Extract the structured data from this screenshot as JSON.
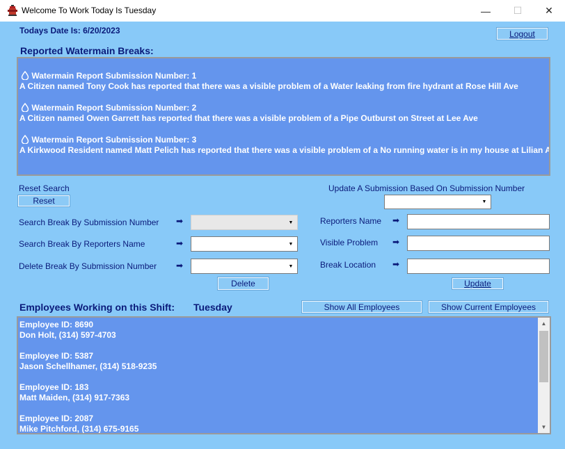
{
  "window": {
    "title": "Welcome To Work Today Is Tuesday",
    "minimize": "—",
    "maximize": "☐",
    "close": "✕"
  },
  "header": {
    "date_label": "Todays Date Is: 6/20/2023",
    "logout_label": "Logout"
  },
  "breaks": {
    "heading": "Reported Watermain Breaks:",
    "reports": [
      {
        "title": "Watermain Report Submission Number: 1",
        "text": "A Citizen named Tony Cook has reported that there was a visible problem of a Water leaking from fire hydrant at Rose Hill Ave"
      },
      {
        "title": "Watermain Report Submission Number: 2",
        "text": "A Citizen named Owen Garrett has reported that there was a visible problem of a Pipe Outburst on Street at Lee Ave"
      },
      {
        "title": "Watermain Report Submission Number: 3",
        "text": "A Kirkwood Resident named Matt Pelich has reported that there was a visible problem of a No running water is in my house at Lilian Ave"
      }
    ]
  },
  "search": {
    "reset_search_label": "Reset Search",
    "reset_button": "Reset",
    "by_number_label": "Search Break By Submission Number",
    "by_name_label": "Search Break By Reporters Name",
    "delete_label": "Delete Break By Submission Number",
    "delete_button": "Delete",
    "arrow": "➡"
  },
  "update": {
    "heading": "Update A Submission Based On Submission Number",
    "reporter_label": "Reporters Name",
    "problem_label": "Visible Problem",
    "location_label": "Break Location",
    "update_button": "Update"
  },
  "employees": {
    "heading": "Employees Working on this Shift:",
    "day": "Tuesday",
    "show_all_button": "Show All Employees",
    "show_current_button": "Show Current Employees",
    "list": [
      {
        "id": "Employee ID: 8690",
        "contact": "Don Holt, (314) 597-4703"
      },
      {
        "id": "Employee ID: 5387",
        "contact": "Jason Schellhamer, (314) 518-9235"
      },
      {
        "id": "Employee ID: 183",
        "contact": "Matt Maiden, (314) 917-7363"
      },
      {
        "id": "Employee ID: 2087",
        "contact": "Mike Pitchford, (314) 675-9165"
      }
    ]
  },
  "colors": {
    "background": "#88c9f8",
    "panel": "#6495ed",
    "text": "#0a1a7a"
  }
}
